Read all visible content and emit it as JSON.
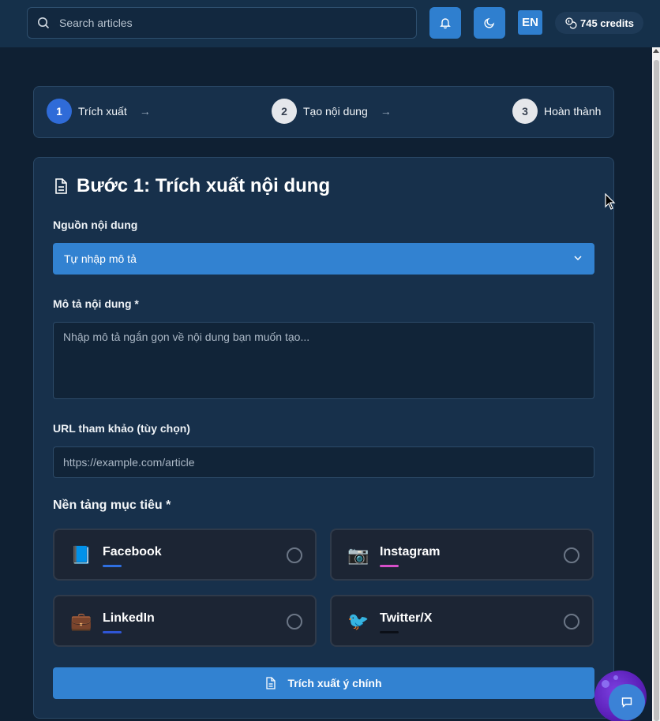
{
  "header": {
    "search_placeholder": "Search articles",
    "language": "EN",
    "credits": "745 credits"
  },
  "stepper": {
    "steps": [
      {
        "num": "1",
        "label": "Trích xuất",
        "state": "active"
      },
      {
        "num": "2",
        "label": "Tạo nội dung",
        "state": "idle"
      },
      {
        "num": "3",
        "label": "Hoàn thành",
        "state": "idle"
      }
    ]
  },
  "form": {
    "title": "Bước 1: Trích xuất nội dung",
    "source_label": "Nguồn nội dung",
    "source_value": "Tự nhập mô tả",
    "description_label": "Mô tả nội dung *",
    "description_placeholder": "Nhập mô tả ngắn gọn về nội dung bạn muốn tạo...",
    "url_label": "URL tham khảo (tùy chọn)",
    "url_placeholder": "https://example.com/article",
    "platforms_label": "Nền tảng mục tiêu *",
    "platforms": [
      {
        "name": "Facebook",
        "emoji": "📘",
        "color": "#2f6fe0"
      },
      {
        "name": "Instagram",
        "emoji": "📷",
        "color": "#d64fc9"
      },
      {
        "name": "LinkedIn",
        "emoji": "💼",
        "color": "#2f55d4"
      },
      {
        "name": "Twitter/X",
        "emoji": "🐦",
        "color": "#0b0f17"
      }
    ],
    "submit_label": "Trích xuất ý chính"
  },
  "colors": {
    "accent": "#3282d1",
    "background": "#0f2033",
    "panel": "#17304b"
  }
}
